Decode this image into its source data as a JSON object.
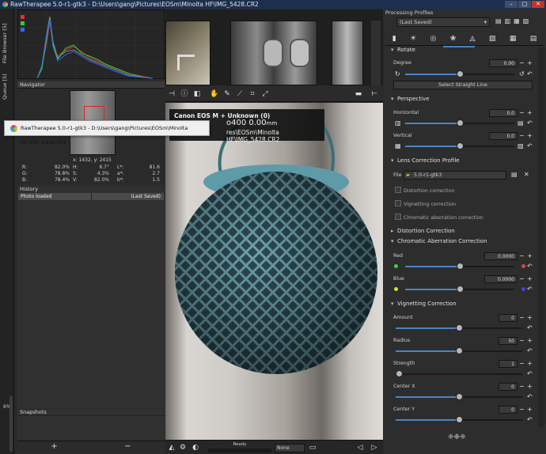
{
  "titlebar": {
    "title": "RawTherapee 5.0-r1-gtk3 - D:\\Users\\gang\\Pictures\\EOSm\\Minolta HF\\IMG_5428.CR2"
  },
  "left_tabs": {
    "file_browser": "File Browser [5]",
    "queue": "Queue [5]"
  },
  "navigator": {
    "title": "Navigator",
    "coords": "x: 1432, y: 2415",
    "rgb": [
      {
        "k": "R:",
        "v": "82.0%"
      },
      {
        "k": "G:",
        "v": "78.8%"
      },
      {
        "k": "B:",
        "v": "78.4%"
      }
    ],
    "hsv": [
      {
        "k": "H:",
        "v": "6.7°"
      },
      {
        "k": "S:",
        "v": "4.3%"
      },
      {
        "k": "V:",
        "v": "82.0%"
      }
    ],
    "lab": [
      {
        "k": "L*:",
        "v": "81.6"
      },
      {
        "k": "a*:",
        "v": "2.7"
      },
      {
        "k": "b*:",
        "v": "1.5"
      }
    ]
  },
  "history": {
    "title": "History",
    "rows": [
      {
        "action": "Photo loaded",
        "value": "(Last Saved)"
      }
    ]
  },
  "zoom_pct": "6%",
  "snapshots": {
    "title": "Snapshots",
    "add": "+",
    "remove": "−"
  },
  "overlay": {
    "camera": "Canon EOS M + Unknown  (0)",
    "iso": "o400  0.00",
    "unit": "mm",
    "path": "res\\EOSm\\Minolta HF\\IMG_5428.CR2"
  },
  "tooltip": {
    "text": "RawTherapee 5.0-r1-gtk3 - D:\\Users\\gang\\Pictures\\EOSm\\Minolta HF\\IMG_5428.CR2"
  },
  "status": {
    "text": "Ready",
    "select": "None"
  },
  "processing_profiles": {
    "title": "Processing Profiles",
    "selected": "(Last Saved)"
  },
  "rotate": {
    "title": "Rotate",
    "label": "Degree",
    "value": "0.00",
    "button": "Select Straight Line"
  },
  "perspective": {
    "title": "Perspective",
    "horizontal_label": "Horizontal",
    "horizontal": "0.0",
    "vertical_label": "Vertical",
    "vertical": "0.0"
  },
  "lens_profile": {
    "title": "Lens Correction Profile",
    "file_label": "File",
    "file": "5.0-r1-gtk3",
    "checks": [
      "Distortion correction",
      "Vignetting correction",
      "Chromatic aberration correction"
    ]
  },
  "distortion": {
    "title": "Distortion Correction"
  },
  "ca": {
    "title": "Chromatic Aberration Correction",
    "red_label": "Red",
    "red": "0.0000",
    "blue_label": "Blue",
    "blue": "0.0000"
  },
  "vignetting": {
    "title": "Vignetting Correction",
    "amount_label": "Amount",
    "amount": "0",
    "radius_label": "Radius",
    "radius": "50",
    "strength_label": "Strength",
    "strength": "1",
    "cx_label": "Center X",
    "cx": "0",
    "cy_label": "Center Y",
    "cy": "0"
  },
  "colors": {
    "titlebar": "#1d2f4e",
    "accent": "#4a84c4",
    "close": "#c2352b"
  }
}
